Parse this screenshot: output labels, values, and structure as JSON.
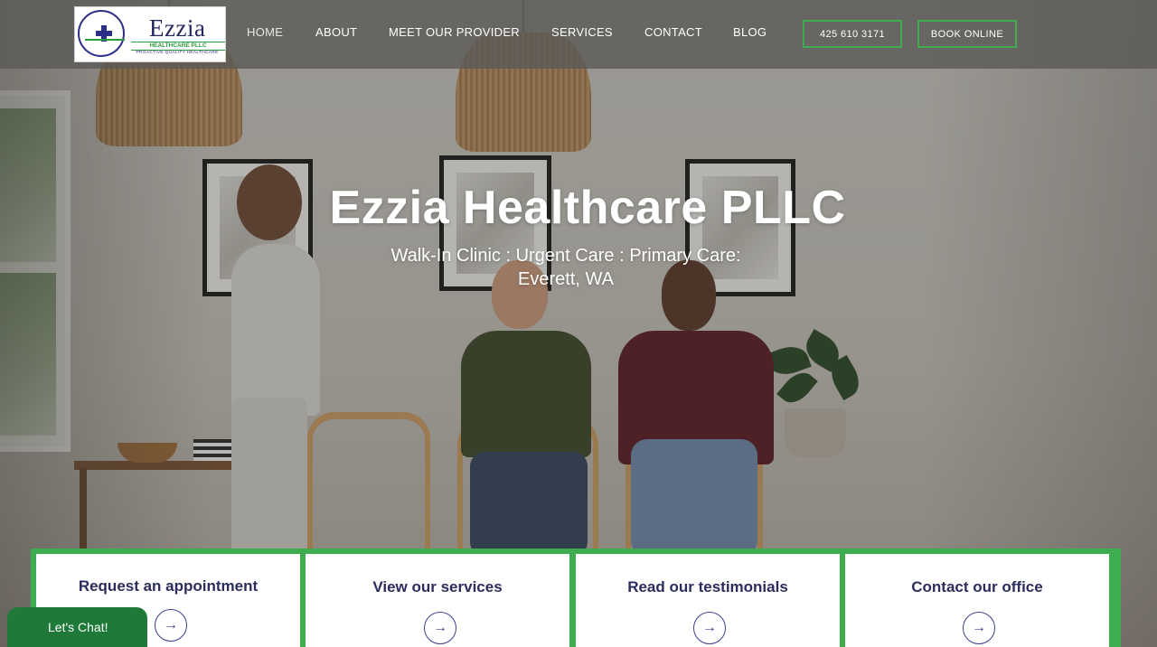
{
  "logo": {
    "name": "Ezzia",
    "subtitle": "HEALTHCARE PLLC",
    "tagline": "PROACTIVE QUALITY HEALTHCARE"
  },
  "nav": {
    "items": [
      {
        "label": "HOME",
        "active": true
      },
      {
        "label": "ABOUT",
        "active": false
      },
      {
        "label": "MEET OUR PROVIDER",
        "active": false
      },
      {
        "label": "SERVICES",
        "active": false
      },
      {
        "label": "CONTACT",
        "active": false
      },
      {
        "label": "BLOG",
        "active": false
      }
    ],
    "phone_label": "425 610 3171",
    "book_label": "BOOK ONLINE"
  },
  "hero": {
    "title": "Ezzia Healthcare PLLC",
    "subtitle_line1": "Walk-In Clinic : Urgent Care : Primary Care:",
    "subtitle_line2": "Everett, WA"
  },
  "cards": [
    {
      "title": "Request an appointment",
      "arrow": "→",
      "icon": "arrow-right-icon"
    },
    {
      "title": "View our services",
      "arrow": "→",
      "icon": "arrow-right-icon"
    },
    {
      "title": "Read our testimonials",
      "arrow": "→",
      "icon": "arrow-right-icon"
    },
    {
      "title": "Contact our office",
      "arrow": "→",
      "icon": "arrow-right-icon"
    }
  ],
  "chat": {
    "label": "Let's Chat!"
  },
  "colors": {
    "accent_green": "#3dad4f",
    "header_bg": "#5c5a57",
    "card_title": "#2b2d5c",
    "chat_green": "#1f7a3a"
  }
}
